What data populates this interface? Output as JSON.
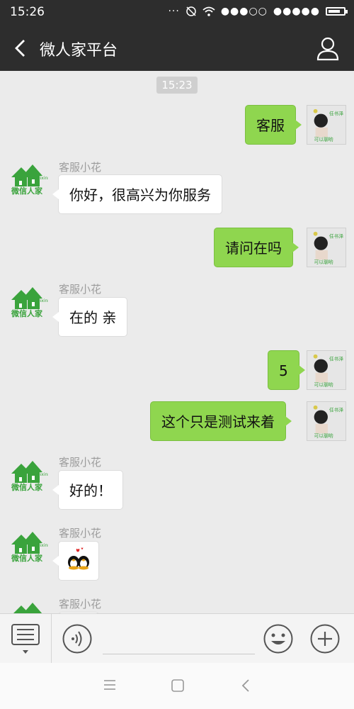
{
  "status_bar": {
    "time": "15:26",
    "signal1": "●●●○○",
    "signal2": "●●●●●"
  },
  "header": {
    "back_icon": "chevron-left-icon",
    "title": "微人家平台",
    "profile_icon": "user-icon"
  },
  "chat": {
    "timestamp": "15:23",
    "sender_name": "客服小花",
    "agent_logo_text": "微信人家",
    "agent_logo_sub": "weixinrj",
    "self_avatar_top": "任书泽",
    "self_avatar_bottom": "可以聊哟",
    "messages": [
      {
        "side": "right",
        "text": "客服"
      },
      {
        "side": "left",
        "text": "你好，很高兴为你服务"
      },
      {
        "side": "right",
        "text": "请问在吗"
      },
      {
        "side": "left",
        "text": "在的 亲"
      },
      {
        "side": "right",
        "text": "5"
      },
      {
        "side": "right",
        "text": "这个只是测试来着"
      },
      {
        "side": "left",
        "text": "好的！"
      },
      {
        "side": "left",
        "text": "",
        "sticker": "penguin-couple-sticker"
      },
      {
        "side": "left",
        "text": ""
      }
    ]
  },
  "bottom_bar": {
    "menu_icon": "list-menu-icon",
    "voice_icon": "voice-icon",
    "emoji_icon": "smiley-icon",
    "plus_icon": "plus-icon",
    "input_value": ""
  },
  "system_nav": {
    "menu_icon": "menu-icon",
    "home_icon": "square-icon",
    "back_icon": "triangle-back-icon"
  },
  "colors": {
    "header_bg": "#2d2d2d",
    "chat_bg": "#ebebeb",
    "self_bubble": "#8fd64f",
    "other_bubble": "#ffffff",
    "logo_green": "#3aa33c"
  }
}
